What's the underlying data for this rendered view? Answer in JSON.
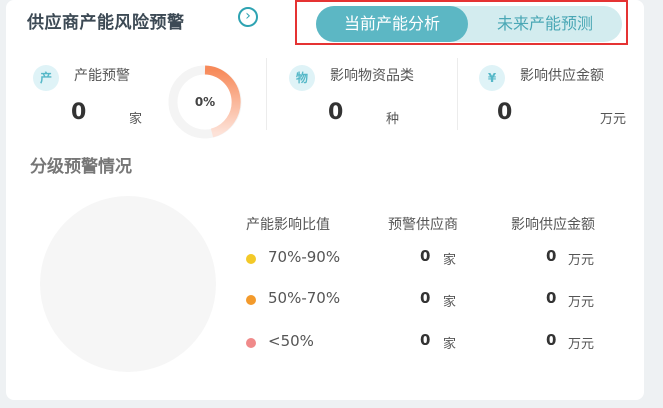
{
  "header": {
    "title": "供应商产能风险预警",
    "arrow": "›"
  },
  "tabs": [
    {
      "label": "当前产能分析",
      "active": true
    },
    {
      "label": "未来产能预测",
      "active": false
    }
  ],
  "metrics": {
    "capacity_warning": {
      "icon": "产",
      "label": "产能预警",
      "value": "0",
      "unit": "家",
      "ring_percent": "0%"
    },
    "affected_categories": {
      "icon": "物",
      "label": "影响物资品类",
      "value": "0",
      "unit": "种"
    },
    "affected_amount": {
      "icon": "¥",
      "label": "影响供应金额",
      "value": "0",
      "unit": "万元"
    }
  },
  "grading": {
    "title": "分级预警情况",
    "columns": [
      "产能影响比值",
      "预警供应商",
      "影响供应金额"
    ],
    "rows": [
      {
        "range": "70%-90%",
        "color": "#f3c928",
        "suppliers": "0",
        "supplier_unit": "家",
        "amount": "0",
        "amount_unit": "万元"
      },
      {
        "range": "50%-70%",
        "color": "#f39a2c",
        "suppliers": "0",
        "supplier_unit": "家",
        "amount": "0",
        "amount_unit": "万元"
      },
      {
        "range": "<50%",
        "color": "#f08a8a",
        "suppliers": "0",
        "supplier_unit": "家",
        "amount": "0",
        "amount_unit": "万元"
      }
    ]
  }
}
